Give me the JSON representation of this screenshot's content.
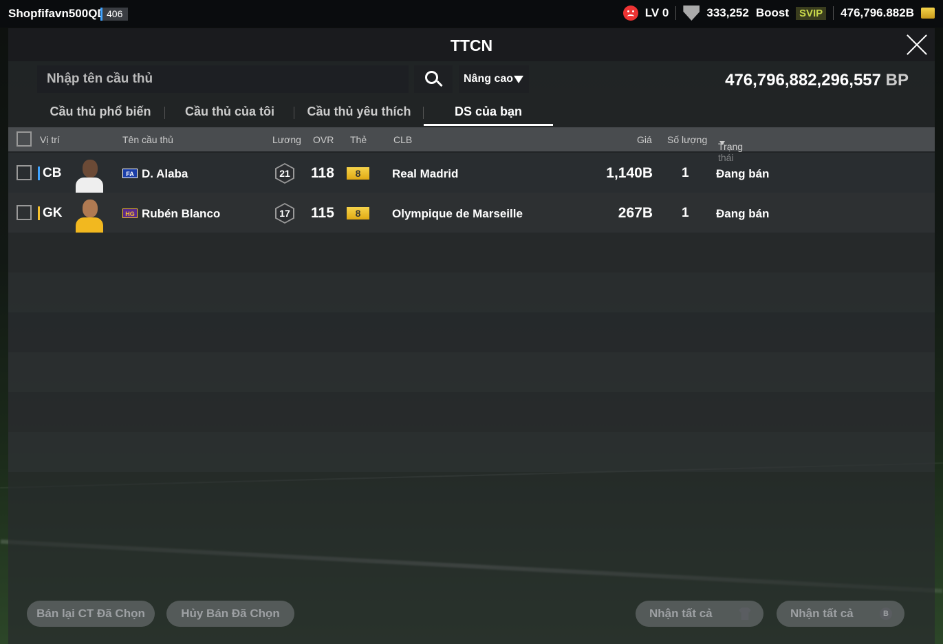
{
  "topbar": {
    "username": "Shopfifavn500QD",
    "user_level": "406",
    "lv": "LV 0",
    "shield_count": "333,252",
    "boost_label": "Boost",
    "svip_label": "SVIP",
    "coins": "476,796.882B"
  },
  "modal": {
    "title": "TTCN",
    "search_placeholder": "Nhập tên cầu thủ",
    "advanced_label": "Nâng cao",
    "bp_amount": "476,796,882,296,557",
    "bp_unit": "BP"
  },
  "tabs": [
    {
      "label": "Cầu thủ phổ biến",
      "active": false
    },
    {
      "label": "Cầu thủ của tôi",
      "active": false
    },
    {
      "label": "Cầu thủ yêu thích",
      "active": false
    },
    {
      "label": "DS của bạn",
      "active": true
    }
  ],
  "table": {
    "headers": {
      "position": "Vị trí",
      "name": "Tên cầu thủ",
      "salary": "Lương",
      "ovr": "OVR",
      "card": "Thẻ",
      "club": "CLB",
      "price": "Giá",
      "quantity": "Số lượng",
      "status": "Trạng thái"
    },
    "rows": [
      {
        "position": "CB",
        "season_badge": "FA",
        "name": "D. Alaba",
        "salary": "21",
        "ovr": "118",
        "grade": "8",
        "club": "Real Madrid",
        "price": "1,140B",
        "quantity": "1",
        "status": "Đang bán"
      },
      {
        "position": "GK",
        "season_badge": "HG",
        "name": "Rubén Blanco",
        "salary": "17",
        "ovr": "115",
        "grade": "8",
        "club": "Olympique de Marseille",
        "price": "267B",
        "quantity": "1",
        "status": "Đang bán"
      }
    ]
  },
  "footer": {
    "resell_label": "Bán lại CT Đã Chọn",
    "cancel_label": "Hủy Bán Đã Chọn",
    "claim_all_items_label": "Nhận tất cả",
    "claim_all_bp_label": "Nhận tất cả"
  },
  "colors": {
    "cb_accent": "#3fa3ff",
    "gk_accent": "#f6c12e",
    "grade_gold": "#f6d34a"
  }
}
